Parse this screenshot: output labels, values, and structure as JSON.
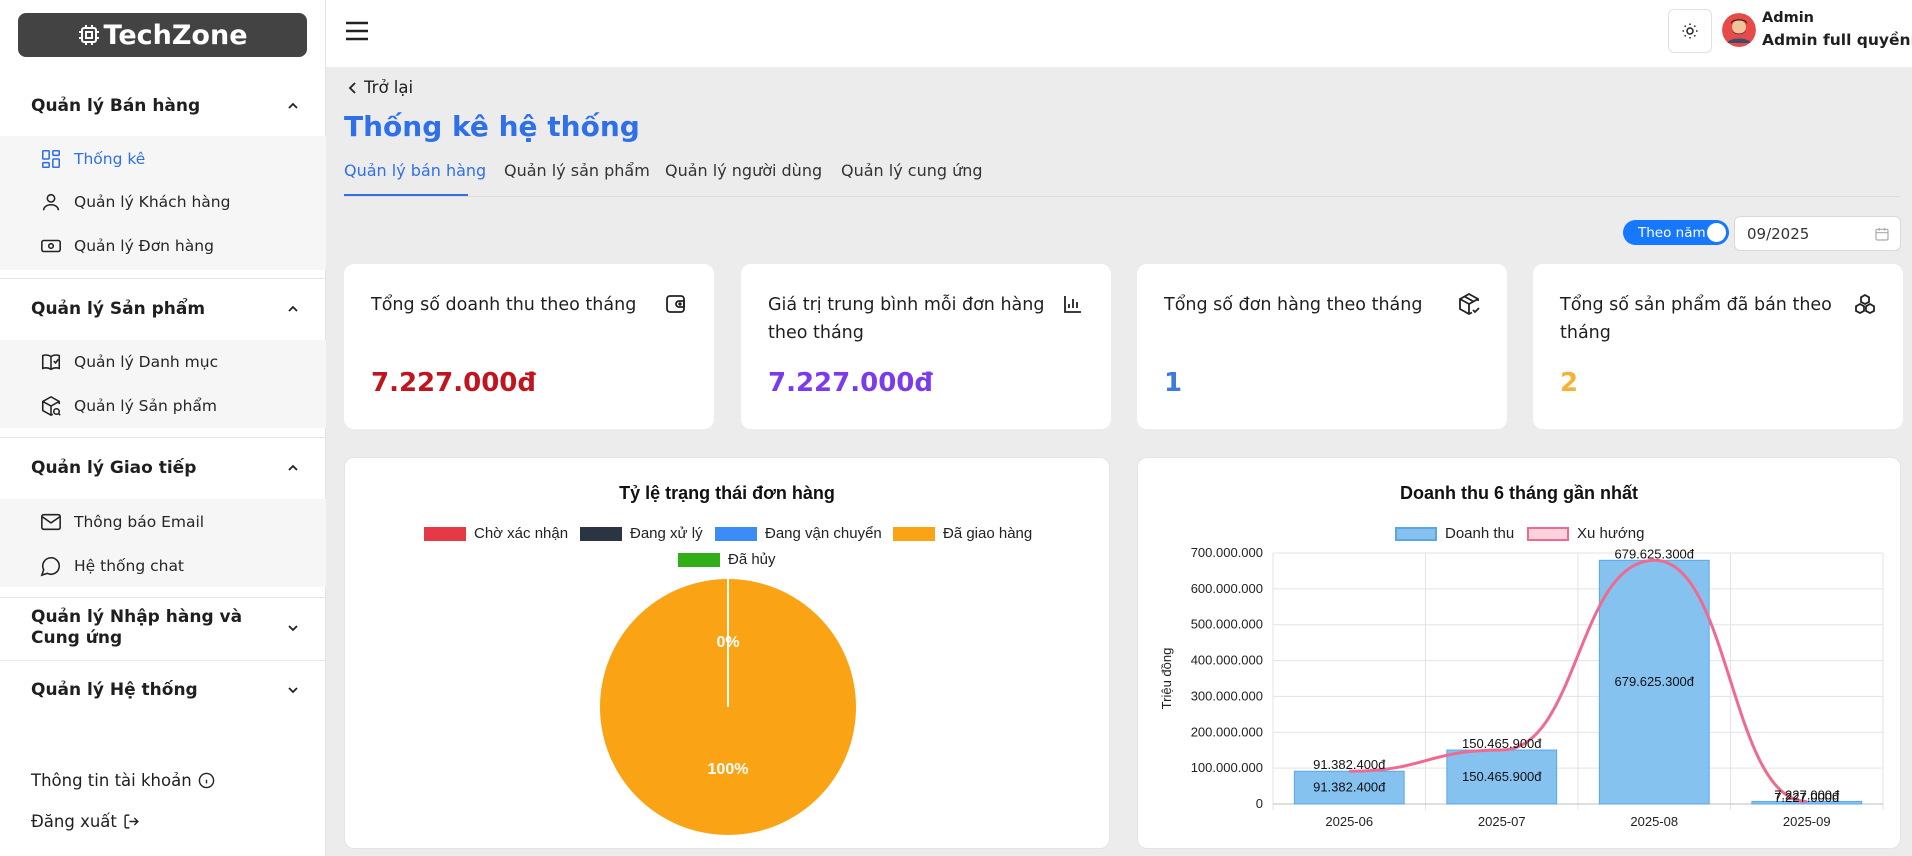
{
  "app": {
    "logo_text": "TechZone"
  },
  "sidebar": {
    "groups": [
      {
        "label": "Quản lý Bán hàng",
        "items": [
          {
            "label": "Thống kê"
          },
          {
            "label": "Quản lý Khách hàng"
          },
          {
            "label": "Quản lý Đơn hàng"
          }
        ]
      },
      {
        "label": "Quản lý Sản phẩm",
        "items": [
          {
            "label": "Quản lý Danh mục"
          },
          {
            "label": "Quản lý Sản phẩm"
          }
        ]
      },
      {
        "label": "Quản lý Giao tiếp",
        "items": [
          {
            "label": "Thông báo Email"
          },
          {
            "label": "Hệ thống chat"
          }
        ]
      },
      {
        "label": "Quản lý Nhập hàng và Cung ứng"
      },
      {
        "label": "Quản lý Hệ thống"
      }
    ],
    "account_link": "Thông tin tài khoản",
    "logout_link": "Đăng xuất"
  },
  "header": {
    "user_name": "Admin",
    "user_role": "Admin full quyềnn..."
  },
  "page": {
    "back_label": "Trở lại",
    "title": "Thống kê hệ thống",
    "tabs": [
      {
        "label": "Quản lý bán hàng",
        "active": true
      },
      {
        "label": "Quản lý sản phẩm"
      },
      {
        "label": "Quản lý người dùng"
      },
      {
        "label": "Quản lý cung ứng"
      }
    ],
    "toggle_label": "Theo năm",
    "date_value": "09/2025"
  },
  "cards": [
    {
      "label": "Tổng số doanh thu theo tháng",
      "value": "7.227.000đ",
      "color": "#c0151f",
      "icon": "wallet-icon"
    },
    {
      "label": "Giá trị trung bình mỗi đơn hàng theo tháng",
      "value": "7.227.000đ",
      "color": "#7c3aed",
      "icon": "bar-chart-icon"
    },
    {
      "label": "Tổng số đơn hàng theo tháng",
      "value": "1",
      "color": "#3b7ddd",
      "icon": "package-check-icon"
    },
    {
      "label": "Tổng số sản phẩm đã bán theo tháng",
      "value": "2",
      "color": "#f5b335",
      "icon": "boxes-icon"
    }
  ],
  "chart_data": [
    {
      "type": "pie",
      "title": "Tỷ lệ trạng thái đơn hàng",
      "categories": [
        "Chờ xác nhận",
        "Đang xử lý",
        "Đang vận chuyển",
        "Đã giao hàng",
        "Đã hủy"
      ],
      "values": [
        0,
        0,
        0,
        100,
        0
      ],
      "colors": [
        "#e63946",
        "#2b3443",
        "#3b8cf5",
        "#faa314",
        "#2fae18"
      ],
      "data_labels": [
        "0%",
        "100%"
      ],
      "legend_position": "top"
    },
    {
      "type": "bar",
      "title": "Doanh thu 6 tháng gần nhất",
      "categories": [
        "2025-06",
        "2025-07",
        "2025-08",
        "2025-09"
      ],
      "series": [
        {
          "name": "Doanh thu",
          "type": "bar",
          "values": [
            91382400,
            150465900,
            679625300,
            7227000
          ],
          "color": "#86c2f0"
        },
        {
          "name": "Xu hướng",
          "type": "line",
          "values": [
            91382400,
            150465900,
            679625300,
            7227000
          ],
          "color": "#f06a8f"
        }
      ],
      "value_labels": [
        "91.382.400đ",
        "150.465.900đ",
        "679.625.300đ",
        "7.227.000đ"
      ],
      "ylabel": "Triệu đồng",
      "ylim": [
        0,
        700000000
      ],
      "yticks": [
        0,
        100000000,
        200000000,
        300000000,
        400000000,
        500000000,
        600000000,
        700000000
      ],
      "ytick_labels": [
        "0",
        "100.000.000",
        "200.000.000",
        "300.000.000",
        "400.000.000",
        "500.000.000",
        "600.000.000",
        "700.000.000"
      ],
      "grid": true,
      "legend_position": "top"
    }
  ]
}
